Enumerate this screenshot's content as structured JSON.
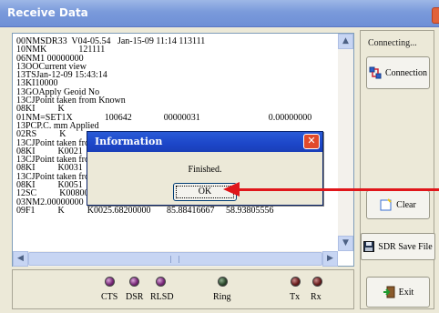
{
  "window": {
    "title": "Receive Data"
  },
  "data_lines": [
    "00NMSDR33  V04-05.54   Jan-15-09 11:14 113111",
    "10NMK              121111",
    "06NM1 00000000",
    "13OOCurrent view",
    "13TSJan-12-09 15:43:14",
    "13KI10000",
    "13GOApply Geoid No",
    "13CJPoint taken from Known",
    "08KI          K",
    "01NM=SET1X              100642              00000031                              0.00000000",
    "13PCP.C. mm Applied",
    "02RS          K",
    "13CJPoint taken fro",
    "08KI          K0021",
    "13CJPoint taken fro",
    "08KI          K0031",
    "13CJPoint taken fro",
    "08KI          K0051",
    "12SC          K0080011111",
    "03NM2.00000000",
    "09F1          K          K0025.68200000       85.88416667     58.93805556"
  ],
  "status": {
    "text": "Connecting..."
  },
  "buttons": {
    "connection": "Connection",
    "clear": "Clear",
    "sdr_save": "SDR Save File",
    "exit": "Exit"
  },
  "leds": [
    {
      "label": "CTS",
      "color": "purple"
    },
    {
      "label": "DSR",
      "color": "purple"
    },
    {
      "label": "RLSD",
      "color": "purple"
    },
    {
      "label": "Ring",
      "color": "green"
    },
    {
      "label": "Tx",
      "color": "red"
    },
    {
      "label": "Rx",
      "color": "red"
    }
  ],
  "dialog": {
    "title": "Information",
    "message": "Finished.",
    "ok_label": "OK",
    "close_glyph": "✕"
  },
  "colors": {
    "title_bar": "#7a9adb",
    "dialog_title": "#1c46c8",
    "annotation_arrow": "#e0161a"
  }
}
